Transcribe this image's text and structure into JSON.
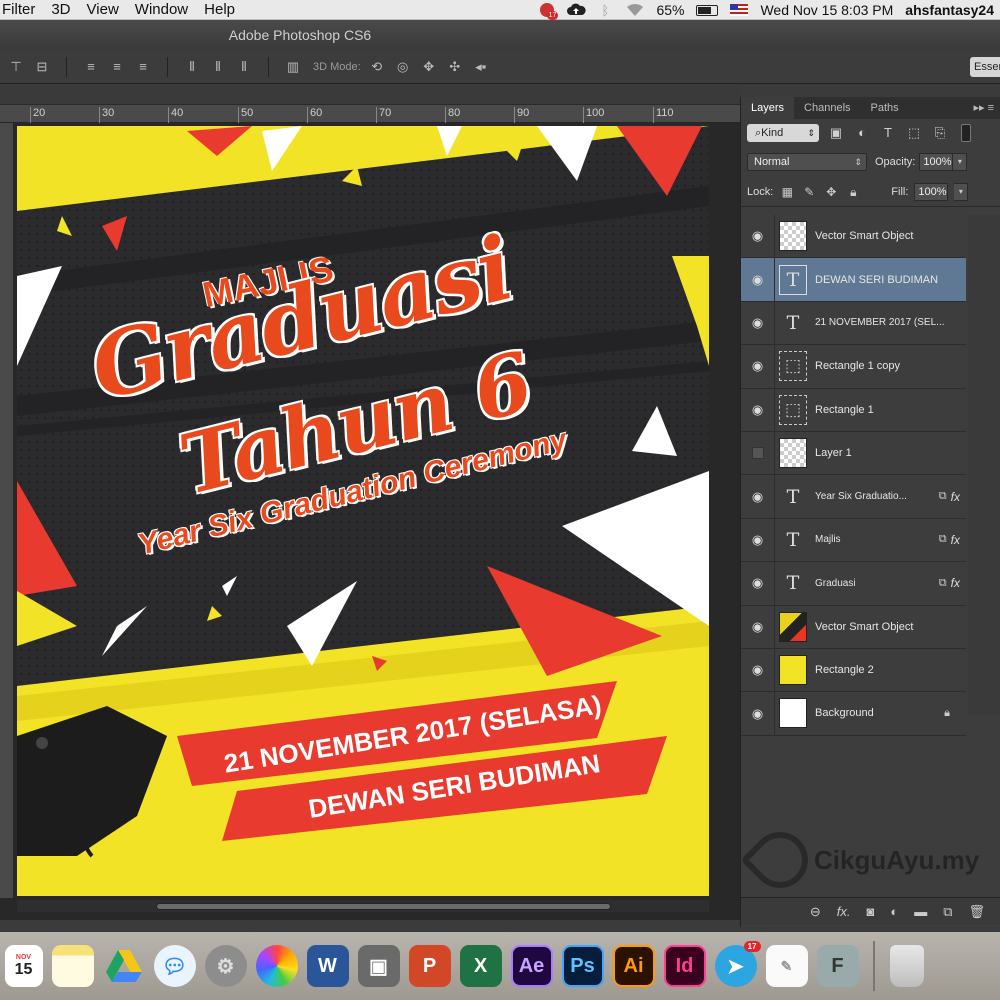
{
  "menubar": {
    "items": [
      "Filter",
      "3D",
      "View",
      "Window",
      "Help"
    ],
    "badge": "17",
    "battery": "65%",
    "datetime": "Wed Nov 15  8:03 PM",
    "user": "ahsfantasy24"
  },
  "window": {
    "title": "Adobe Photoshop CS6"
  },
  "options_bar": {
    "mode_label": "3D Mode:",
    "workspace_label": "Essentials"
  },
  "ruler": {
    "ticks": [
      "20",
      "30",
      "40",
      "50",
      "60",
      "70",
      "80",
      "90",
      "100",
      "110"
    ]
  },
  "poster": {
    "majlis": "MAJLIS",
    "graduasi": "Graduasi",
    "tahun": "Tahun 6",
    "subtitle": "Year Six Graduation Ceremony",
    "date": "21 NOVEMBER 2017  (SELASA)",
    "venue": "DEWAN SERI BUDIMAN",
    "colors": {
      "yellow": "#f2e327",
      "red": "#e83a2f",
      "dark": "#2b2b2d",
      "orange": "#e84a1d"
    }
  },
  "panel": {
    "tabs": [
      "Layers",
      "Channels",
      "Paths"
    ],
    "kind": "Kind",
    "blend_mode": "Normal",
    "opacity_label": "Opacity:",
    "opacity": "100%",
    "lock_label": "Lock:",
    "fill_label": "Fill:",
    "fill": "100%"
  },
  "layers": [
    {
      "name": "Vector Smart Object",
      "type": "smart-check",
      "visible": true
    },
    {
      "name": "DEWAN SERI BUDIMAN",
      "type": "text",
      "visible": true,
      "selected": true
    },
    {
      "name": "21 NOVEMBER 2017  (SEL...",
      "type": "text",
      "visible": true
    },
    {
      "name": "Rectangle 1 copy",
      "type": "shape",
      "visible": true
    },
    {
      "name": "Rectangle 1",
      "type": "shape",
      "visible": true
    },
    {
      "name": "Layer 1",
      "type": "check",
      "visible": false
    },
    {
      "name": "Year Six Graduatio...",
      "type": "text-fx",
      "visible": true
    },
    {
      "name": "Majlis",
      "type": "text-fx",
      "visible": true
    },
    {
      "name": "Graduasi",
      "type": "text-fx",
      "visible": true
    },
    {
      "name": "Vector Smart Object",
      "type": "poster",
      "visible": true
    },
    {
      "name": "Rectangle 2",
      "type": "rect2",
      "visible": true
    },
    {
      "name": "Background",
      "type": "bg",
      "visible": true
    }
  ],
  "watermark": {
    "text": "CikguAyu.my"
  },
  "dock": {
    "calendar_month": "NOV",
    "calendar_day": "15",
    "badge": "17",
    "apps": [
      "Notes",
      "Drive",
      "Messages",
      "System Preferences",
      "Photos",
      "Word",
      "Preview",
      "PowerPoint",
      "Excel",
      "Ae",
      "Ps",
      "Ai",
      "Id",
      "Telegram",
      "TextEdit",
      "F",
      "Trash"
    ]
  }
}
